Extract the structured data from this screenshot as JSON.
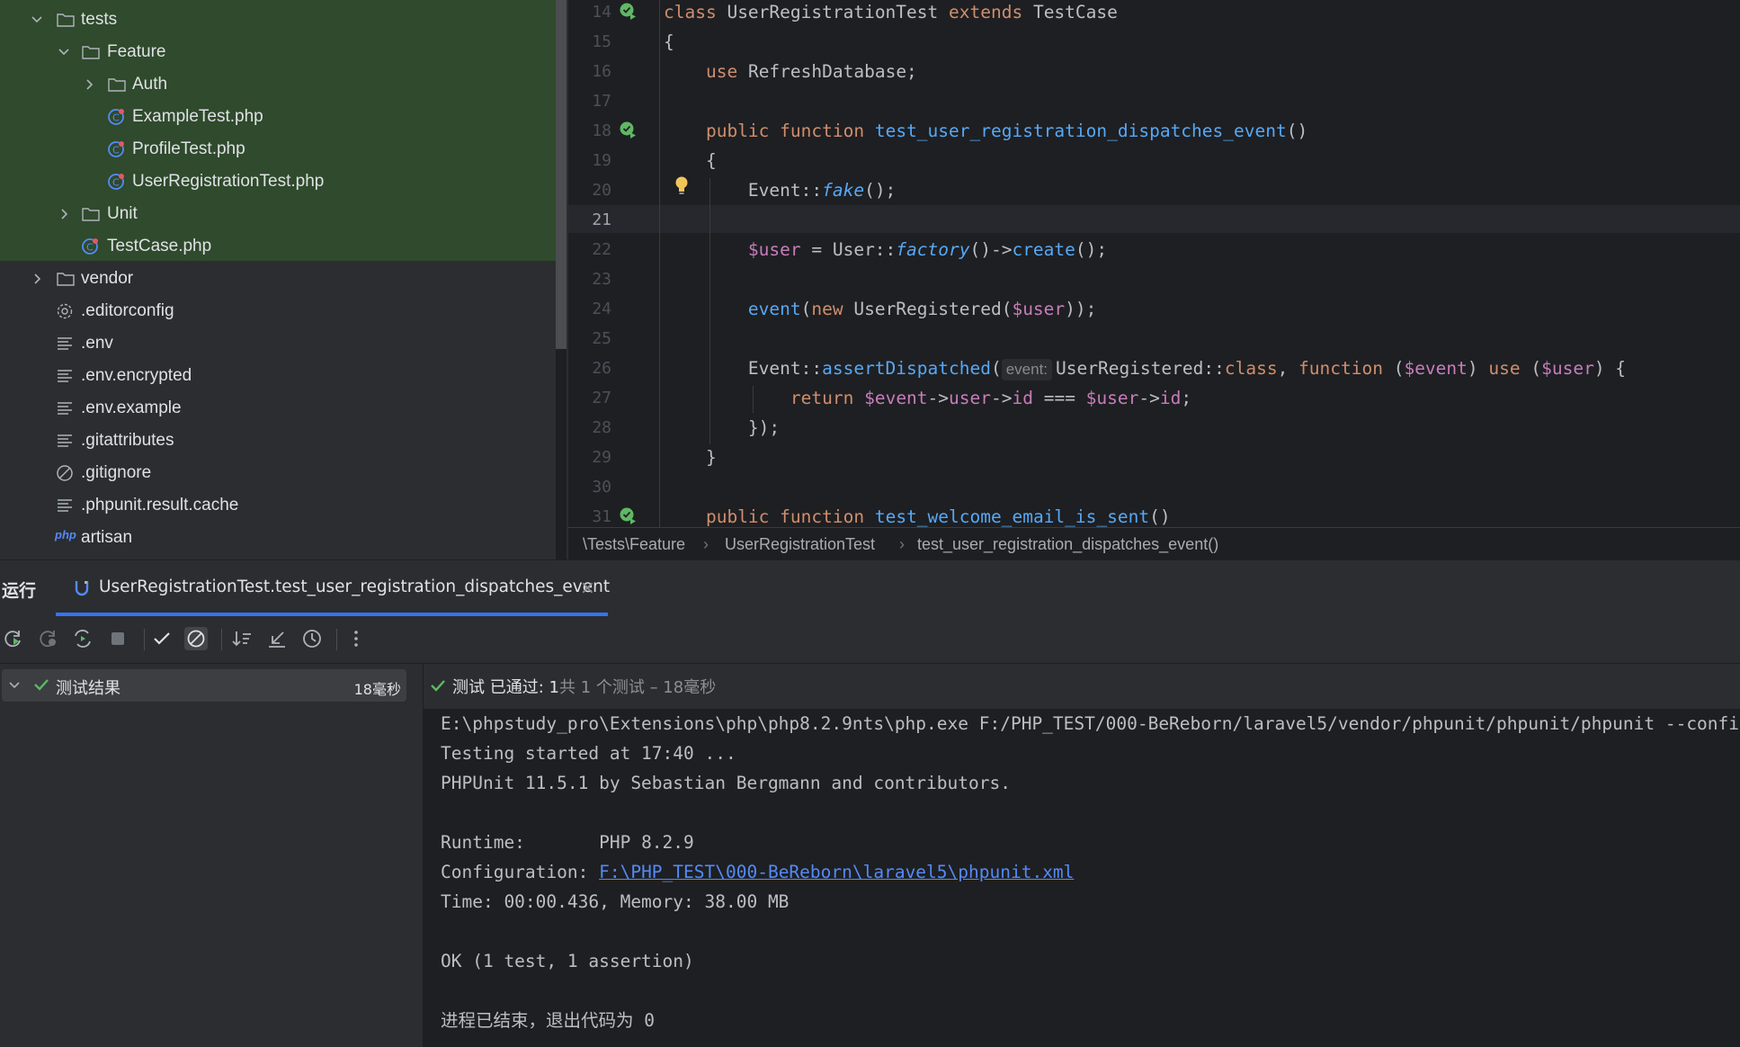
{
  "tree": {
    "items": [
      {
        "label": "tests"
      },
      {
        "label": "Feature"
      },
      {
        "label": "Auth"
      },
      {
        "label": "ExampleTest.php"
      },
      {
        "label": "ProfileTest.php"
      },
      {
        "label": "UserRegistrationTest.php"
      },
      {
        "label": "Unit"
      },
      {
        "label": "TestCase.php"
      },
      {
        "label": "vendor"
      },
      {
        "label": ".editorconfig"
      },
      {
        "label": ".env"
      },
      {
        "label": ".env.encrypted"
      },
      {
        "label": ".env.example"
      },
      {
        "label": ".gitattributes"
      },
      {
        "label": ".gitignore"
      },
      {
        "label": ".phpunit.result.cache"
      },
      {
        "label": "artisan",
        "badge": "php"
      }
    ]
  },
  "editor": {
    "line_numbers": [
      "14",
      "15",
      "16",
      "17",
      "18",
      "19",
      "20",
      "21",
      "22",
      "23",
      "24",
      "25",
      "26",
      "27",
      "28",
      "29",
      "30",
      "31"
    ],
    "active_line": "21",
    "tokens": {
      "class_kw": "class",
      "class_name": "UserRegistrationTest",
      "extends_kw": "extends",
      "parent_class": "TestCase",
      "open_brace": "{",
      "use_kw": "use",
      "trait_name": "RefreshDatabase;",
      "public_kw": "public",
      "function_kw": "function",
      "method1": "test_user_registration_dispatches_event",
      "parens": "()",
      "open_brace2": "{",
      "event_cls": "Event::",
      "fake": "fake",
      "fake_tail": "();",
      "user_var": "$user",
      "assign": " = User::",
      "factory": "factory",
      "arrow_create": "()->",
      "create": "create",
      "create_tail": "();",
      "event_fn": "event",
      "paren_open": "(",
      "new_kw": "new",
      "user_registered_open": " UserRegistered(",
      "user_var2": "$user",
      "close_parens": "));",
      "event_cls2": "Event::",
      "assert_dispatched": "assertDispatched",
      "paren_open2": "(",
      "param_hint": "event:",
      "ur_class": "UserRegistered::",
      "class_kw2": "class",
      "comma": ", ",
      "function_kw2": "function",
      "space_paren": " (",
      "event_var": "$event",
      "paren_close": ") ",
      "use_kw2": "use",
      "space_paren2": " (",
      "user_var3": "$user",
      "close_brace_open": ") {",
      "return_kw": "return",
      "event_var2": "$event",
      "arrow1": "->",
      "user_prop": "user",
      "arrow2": "->",
      "id_prop": "id",
      "triple_eq": " === ",
      "user_var4": "$user",
      "arrow3": "->",
      "id_prop2": "id",
      "semi": ";",
      "close_closure": "});",
      "close_brace": "}",
      "method2": "test_welcome_email_is_sent",
      "parens2": "()"
    }
  },
  "breadcrumb": [
    "\\Tests\\Feature",
    "UserRegistrationTest",
    "test_user_registration_dispatches_event()"
  ],
  "run_panel": {
    "label": "运行",
    "tab_title": "UserRegistrationTest.test_user_registration_dispatches_event",
    "tab_close": "×",
    "results_label": "测试结果",
    "results_time": "18毫秒",
    "status_prefix": "测试 已通过: 1",
    "status_suffix": "共 1 个测试 – 18毫秒",
    "console": {
      "line1": "E:\\phpstudy_pro\\Extensions\\php\\php8.2.9nts\\php.exe F:/PHP_TEST/000-BeReborn/laravel5/vendor/phpunit/phpunit/phpunit --configuration",
      "line2": "Testing started at 17:40 ...",
      "line3": "PHPUnit 11.5.1 by Sebastian Bergmann and contributors.",
      "runtime_label": "Runtime:       ",
      "runtime_value": "PHP 8.2.9",
      "config_label": "Configuration: ",
      "config_link": "F:\\PHP_TEST\\000-BeReborn\\laravel5\\phpunit.xml",
      "time_line": "Time: 00:00.436, Memory: 38.00 MB",
      "ok_line": "OK (1 test, 1 assertion)",
      "exit_line": "进程已结束，退出代码为 0"
    }
  },
  "colors": {
    "accent": "#3574f0",
    "success": "#5fb865",
    "keyword": "#cf8e6d",
    "function": "#56a8f5",
    "variable": "#c77dbb",
    "tree_highlight": "#2f4a2c"
  },
  "icons": {
    "folder": "folder-icon",
    "php_class": "php-class-icon",
    "gear": "gear-icon",
    "text_file": "text-file-icon",
    "ignore": "ignore-icon",
    "run_test": "run-test-icon",
    "bulb": "bulb-icon"
  }
}
